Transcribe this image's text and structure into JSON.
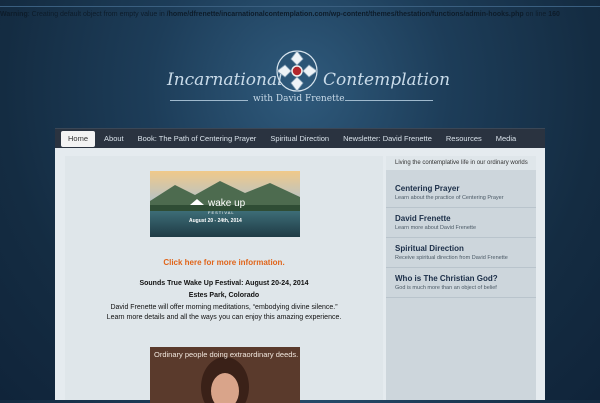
{
  "warning": {
    "label": "Warning",
    "message": ": Creating default object from empty value in",
    "path": "/home/dfrenette/incarnationalcontemplation.com/wp-content/themes/thestation/functions/admin-hooks.php",
    "line_prefix": "on line",
    "line": "160"
  },
  "logo": {
    "left_text": "Incarnational",
    "right_text": "Contemplation",
    "subtitle": "with David Frenette"
  },
  "nav": [
    {
      "label": "Home",
      "active": true
    },
    {
      "label": "About"
    },
    {
      "label": "Book: The Path of Centering Prayer"
    },
    {
      "label": "Spiritual Direction"
    },
    {
      "label": "Newsletter: David Frenette"
    },
    {
      "label": "Resources"
    },
    {
      "label": "Media"
    }
  ],
  "main": {
    "banner_logo": "wake up",
    "banner_festival": "FESTIVAL",
    "banner_dates": "August 20 - 24th, 2014",
    "click_link": "Click here for more information.",
    "fest_title": "Sounds True Wake Up Festival: August 20-24, 2014",
    "fest_place": "Estes Park, Colorado",
    "fest_line1": "David Frenette will offer morning meditations, “embodying divine silence.”",
    "fest_line2": "Learn more details and all the ways you can enjoy this amazing experience.",
    "photo_caption": "Ordinary people doing extraordinary deeds."
  },
  "sidebar": {
    "tagline": "Living the contemplative life in our ordinary worlds",
    "items": [
      {
        "title": "Centering Prayer",
        "desc": "Learn about the practice of Centering Prayer"
      },
      {
        "title": "David Frenette",
        "desc": "Learn more about David Frenette"
      },
      {
        "title": "Spiritual Direction",
        "desc": "Receive spiritual direction from David Frenette"
      },
      {
        "title": "Who is The Christian God?",
        "desc": "God is much more than an object of belief"
      }
    ]
  },
  "colors": {
    "background": "#1d3d59",
    "nav_bar": "#2a3340",
    "link_orange": "#e0651a",
    "sidebar_title": "#1b2e48"
  }
}
